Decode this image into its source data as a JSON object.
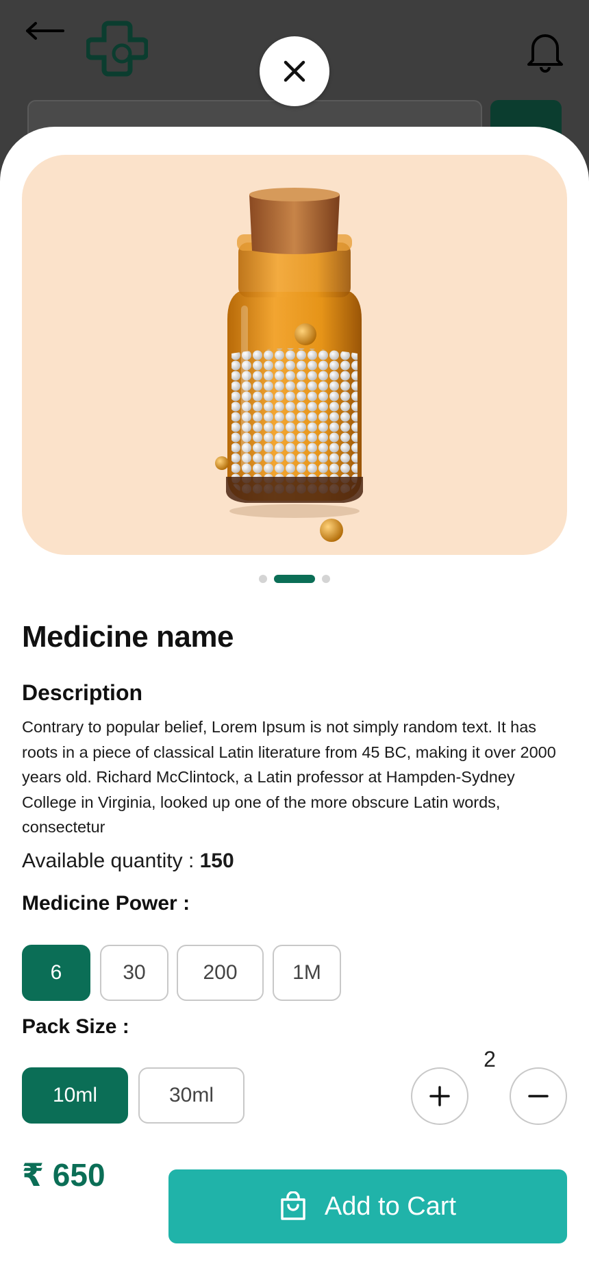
{
  "icons": {
    "back": "arrow-left-icon",
    "logo": "medical-cross-logo",
    "notification": "bell-icon",
    "close": "close-icon",
    "cart": "shopping-bag-icon",
    "plus": "plus-icon",
    "minus": "minus-icon"
  },
  "colors": {
    "primary": "#0b6e56",
    "cart_button": "#20b3a9",
    "image_background": "#fbe2ca",
    "overlay": "#3e3e3e"
  },
  "carousel": {
    "count": 3,
    "active_index": 1
  },
  "product": {
    "name": "Medicine name",
    "description_heading": "Description",
    "description": "Contrary to popular belief, Lorem Ipsum is not simply random text. It has roots in a piece of classical Latin literature from 45 BC, making it over 2000 years old. Richard McClintock, a Latin professor at Hampden-Sydney College in Virginia, looked up one of the more obscure  Latin words, consectetur",
    "available_label": "Available quantity : ",
    "available_value": "150"
  },
  "power": {
    "label": "Medicine Power :",
    "options": [
      "6",
      "30",
      "200",
      "1M"
    ],
    "selected": "6"
  },
  "pack": {
    "label": "Pack Size :",
    "options": [
      "10ml",
      "30ml"
    ],
    "selected": "10ml"
  },
  "quantity": {
    "value": "2"
  },
  "footer": {
    "price": "₹ 650",
    "add_to_cart": "Add to Cart"
  }
}
